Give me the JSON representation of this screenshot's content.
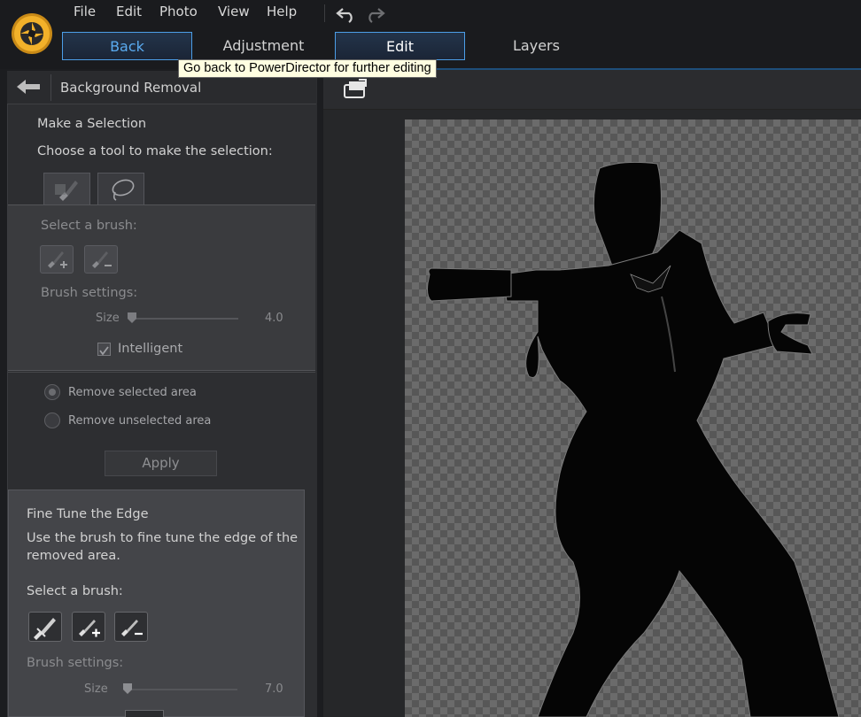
{
  "menu": {
    "file": "File",
    "edit": "Edit",
    "photo": "Photo",
    "view": "View",
    "help": "Help"
  },
  "tabs": {
    "back": "Back",
    "adjustment": "Adjustment",
    "edit": "Edit",
    "layers": "Layers"
  },
  "tooltip": "Go back to PowerDirector for further editing",
  "panel": {
    "title": "Background Removal",
    "make_selection": "Make a Selection",
    "choose_tool": "Choose a tool to make the selection:",
    "select_brush": "Select a brush:",
    "brush_settings": "Brush settings:",
    "size_label": "Size",
    "size_value": "4.0",
    "size_fraction": 0.0,
    "intelligent_label": "Intelligent",
    "intelligent_checked": true,
    "remove_selected": "Remove selected area",
    "remove_unselected": "Remove unselected area",
    "selected_option": "Remove selected area",
    "apply": "Apply"
  },
  "fine_tune": {
    "title": "Fine Tune the Edge",
    "desc_line1": "Use the brush to fine tune the edge of the",
    "desc_line2": "removed area.",
    "select_brush": "Select a brush:",
    "brush_settings": "Brush settings:",
    "size_label": "Size",
    "size_value": "7.0",
    "size_fraction": 0.02
  },
  "icons": {
    "logo": "aperture-logo-icon",
    "undo": "undo-icon",
    "redo": "redo-icon",
    "back": "back-arrow-icon",
    "fit": "fit-to-screen-icon",
    "smart_brush": "smart-brush-icon",
    "lasso": "lasso-icon"
  },
  "colors": {
    "accent": "#4c9ee7",
    "tooltip_bg": "#fffee1",
    "silhouette": "#050505"
  }
}
